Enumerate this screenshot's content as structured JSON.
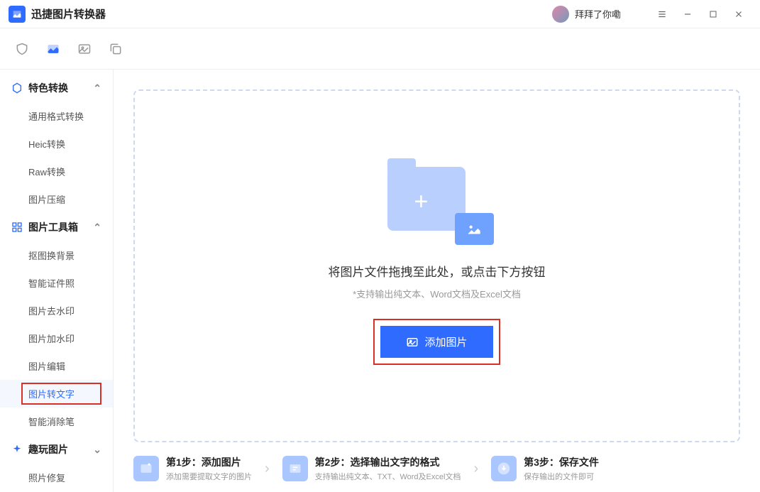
{
  "app": {
    "title": "迅捷图片转换器",
    "username": "拜拜了你嘞"
  },
  "sidebar": {
    "cat_feature": "特色转换",
    "cat_toolkit": "图片工具箱",
    "cat_fun": "趣玩图片",
    "items": {
      "general_convert": "通用格式转换",
      "heic": "Heic转换",
      "raw": "Raw转换",
      "compress": "图片压缩",
      "cutout": "抠图换背景",
      "idphoto": "智能证件照",
      "remove_wm": "图片去水印",
      "add_wm": "图片加水印",
      "edit": "图片编辑",
      "ocr": "图片转文字",
      "eraser": "智能消除笔",
      "repair": "照片修复"
    }
  },
  "drop": {
    "title": "将图片文件拖拽至此处，或点击下方按钮",
    "sub": "*支持输出纯文本、Word文档及Excel文档",
    "button": "添加图片"
  },
  "steps": {
    "s1t": "第1步：添加图片",
    "s1s": "添加需要提取文字的图片",
    "s2t": "第2步：选择输出文字的格式",
    "s2s": "支持输出纯文本、TXT、Word及Excel文档",
    "s3t": "第3步：保存文件",
    "s3s": "保存输出的文件即可"
  }
}
